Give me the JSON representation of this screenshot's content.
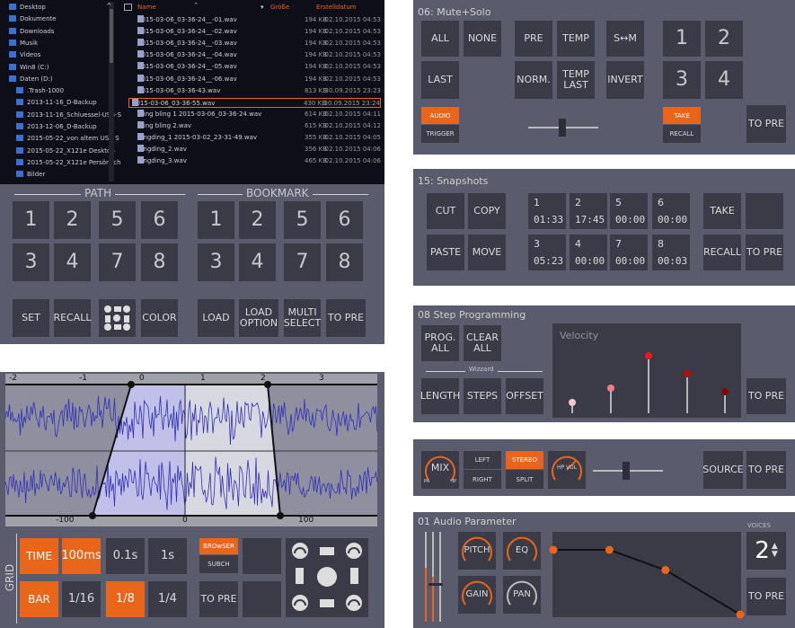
{
  "browser": {
    "tree": [
      "Desktop",
      "Dokumente",
      "Downloads",
      "Musik",
      "Videos",
      "Win8 (C:)",
      "Daten (D:)",
      ".Trash-1000",
      "2013-11-16_D-Backup",
      "2013-11-16_Schluessel-USB-S",
      "2013-12-06_D-Backup",
      "2015-05-22_von altem USB S",
      "2015-05-22_X121e Desktop",
      "2015-05-22_X121e Persönlich",
      "Bilder"
    ],
    "col_name": "Name",
    "col_size": "Größe",
    "col_date": "Erstelldatum",
    "files": [
      {
        "name": "2015-03-06_03-36-24__-01.wav",
        "size": "194 KB",
        "date": "02.10.2015 04:53"
      },
      {
        "name": "2015-03-06_03-36-24__-02.wav",
        "size": "194 KB",
        "date": "02.10.2015 04:53"
      },
      {
        "name": "2015-03-06_03-36-24__-03.wav",
        "size": "194 KB",
        "date": "02.10.2015 04:53"
      },
      {
        "name": "2015-03-06_03-36-24__-04.wav",
        "size": "194 KB",
        "date": "02.10.2015 04:53"
      },
      {
        "name": "2015-03-06_03-36-24__-05.wav",
        "size": "194 KB",
        "date": "02.10.2015 04:53"
      },
      {
        "name": "2015-03-06_03-36-24__-06.wav",
        "size": "194 KB",
        "date": "02.10.2015 04:53"
      },
      {
        "name": "2015-03-06_03-36-43.wav",
        "size": "813 KB",
        "date": "30.09.2015 23:23"
      },
      {
        "name": "2015-03-06_03-36-55.wav",
        "size": "430 KB",
        "date": "30.09.2015 23:24"
      },
      {
        "name": "Bling bling 1  2015-03-06_03-36-24.wav",
        "size": "614 KB",
        "date": "02.10.2015 04:11"
      },
      {
        "name": "Bling bling 2.wav",
        "size": "615 KB",
        "date": "02.10.2015 04:12"
      },
      {
        "name": "dingding_1  2015-03-02_23-31-49.wav",
        "size": "355 KB",
        "date": "02.10.2015 04:05"
      },
      {
        "name": "dingding_2.wav",
        "size": "356 KB",
        "date": "02.10.2015 04:06"
      },
      {
        "name": "dingding_3.wav",
        "size": "465 KB",
        "date": "02.10.2015 04:06"
      }
    ],
    "selected_index": 7,
    "path_label": "PATH",
    "bookmark_label": "BOOKMARK",
    "path_nums": [
      "1",
      "2",
      "5",
      "6",
      "3",
      "4",
      "7",
      "8"
    ],
    "bookmark_nums": [
      "1",
      "2",
      "5",
      "6",
      "3",
      "4",
      "7",
      "8"
    ],
    "set": "SET",
    "recall": "RECALL",
    "color": "COLOR",
    "load": "LOAD",
    "load_option": "LOAD\nOPTION",
    "multi_select": "MULTI\nSELECT",
    "to_pre": "TO PRE"
  },
  "waveform": {
    "top_ticks": [
      "-2",
      "-1",
      "0",
      "1",
      "2",
      "3"
    ],
    "bottom_ticks": [
      "-100",
      "0",
      "100"
    ],
    "grid_label": "GRID",
    "time": "TIME",
    "ms100": "100ms",
    "s01": "0.1s",
    "s1": "1s",
    "bar": "BAR",
    "d16": "1/16",
    "d8": "1/8",
    "d4": "1/4",
    "browser": "BROwSER",
    "subch": "SUBCH",
    "to_pre": "TO PRE"
  },
  "mute": {
    "title": "06: Mute+Solo",
    "all": "ALL",
    "none": "NONE",
    "pre": "PRE",
    "temp": "TEMP",
    "sm": "S↔M",
    "n1": "1",
    "n2": "2",
    "last": "LAST",
    "norm": "NORM.",
    "temp_last": "TEMP\nLAST",
    "invert": "INVERT",
    "n3": "3",
    "n4": "4",
    "audio": "AUDIO",
    "trigger": "TRIGGER",
    "take": "TAKE",
    "recall": "RECALL",
    "to_pre": "TO PRE"
  },
  "snap": {
    "title": "15: Snapshots",
    "cut": "CUT",
    "copy": "COPY",
    "paste": "PASTE",
    "move": "MOVE",
    "slots": [
      {
        "n": "1",
        "t": "01:33"
      },
      {
        "n": "2",
        "t": "17:45"
      },
      {
        "n": "5",
        "t": "00:00"
      },
      {
        "n": "6",
        "t": "00:00"
      },
      {
        "n": "3",
        "t": "05:23"
      },
      {
        "n": "4",
        "t": "00:00"
      },
      {
        "n": "7",
        "t": "00:00"
      },
      {
        "n": "8",
        "t": "00:03"
      }
    ],
    "take": "TAKE",
    "recall": "RECALL",
    "to_pre": "TO PRE"
  },
  "step": {
    "title": "08 Step Programming",
    "prog_all": "PROG.\nALL",
    "clear_all": "CLEAR\nALL",
    "wizard": "Wizzard",
    "length": "LENGTH",
    "steps": "STEPS",
    "offset": "OFFSET",
    "velocity": "Velocity",
    "to_pre": "TO PRE",
    "velocities": [
      0.15,
      0.35,
      0.8,
      0.55,
      0.3
    ],
    "vel_colors": [
      "#f4c8c8",
      "#f08080",
      "#e81818",
      "#b80c0c",
      "#800808"
    ]
  },
  "mix": {
    "mix": "MIX",
    "pa": "PA",
    "hp": "HP",
    "left": "LEFT",
    "right": "RIGHT",
    "stereo": "STEREO",
    "split": "SPLIT",
    "hpvol": "HP VOL",
    "source": "SOURCE",
    "to_pre": "TO PRE"
  },
  "audio": {
    "title": "01 Audio Parameter",
    "voices_label": "VOICES",
    "voices": "2",
    "pitch": "PITCH",
    "eq": "EQ",
    "gain": "GAIN",
    "pan": "PAN",
    "to_pre": "TO PRE",
    "env_points": [
      [
        0,
        0.2
      ],
      [
        0.3,
        0.2
      ],
      [
        0.6,
        0.45
      ],
      [
        1,
        1
      ]
    ]
  },
  "colors": {
    "accent": "#e8651a",
    "panel": "#5b5b6e",
    "button": "#3b3b48"
  }
}
